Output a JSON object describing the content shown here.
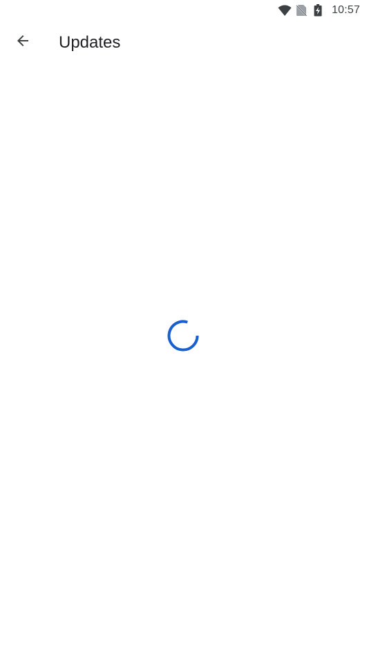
{
  "status_bar": {
    "time": "10:57",
    "icons": [
      "wifi-icon",
      "no-sim-icon",
      "battery-charging-icon"
    ]
  },
  "app_bar": {
    "back_icon": "arrow-back-icon",
    "title": "Updates"
  },
  "main": {
    "loading_indicator": "progress-spinner-icon"
  },
  "colors": {
    "accent": "#1a5fd0",
    "icon": "#3c4043",
    "background": "#ffffff"
  }
}
